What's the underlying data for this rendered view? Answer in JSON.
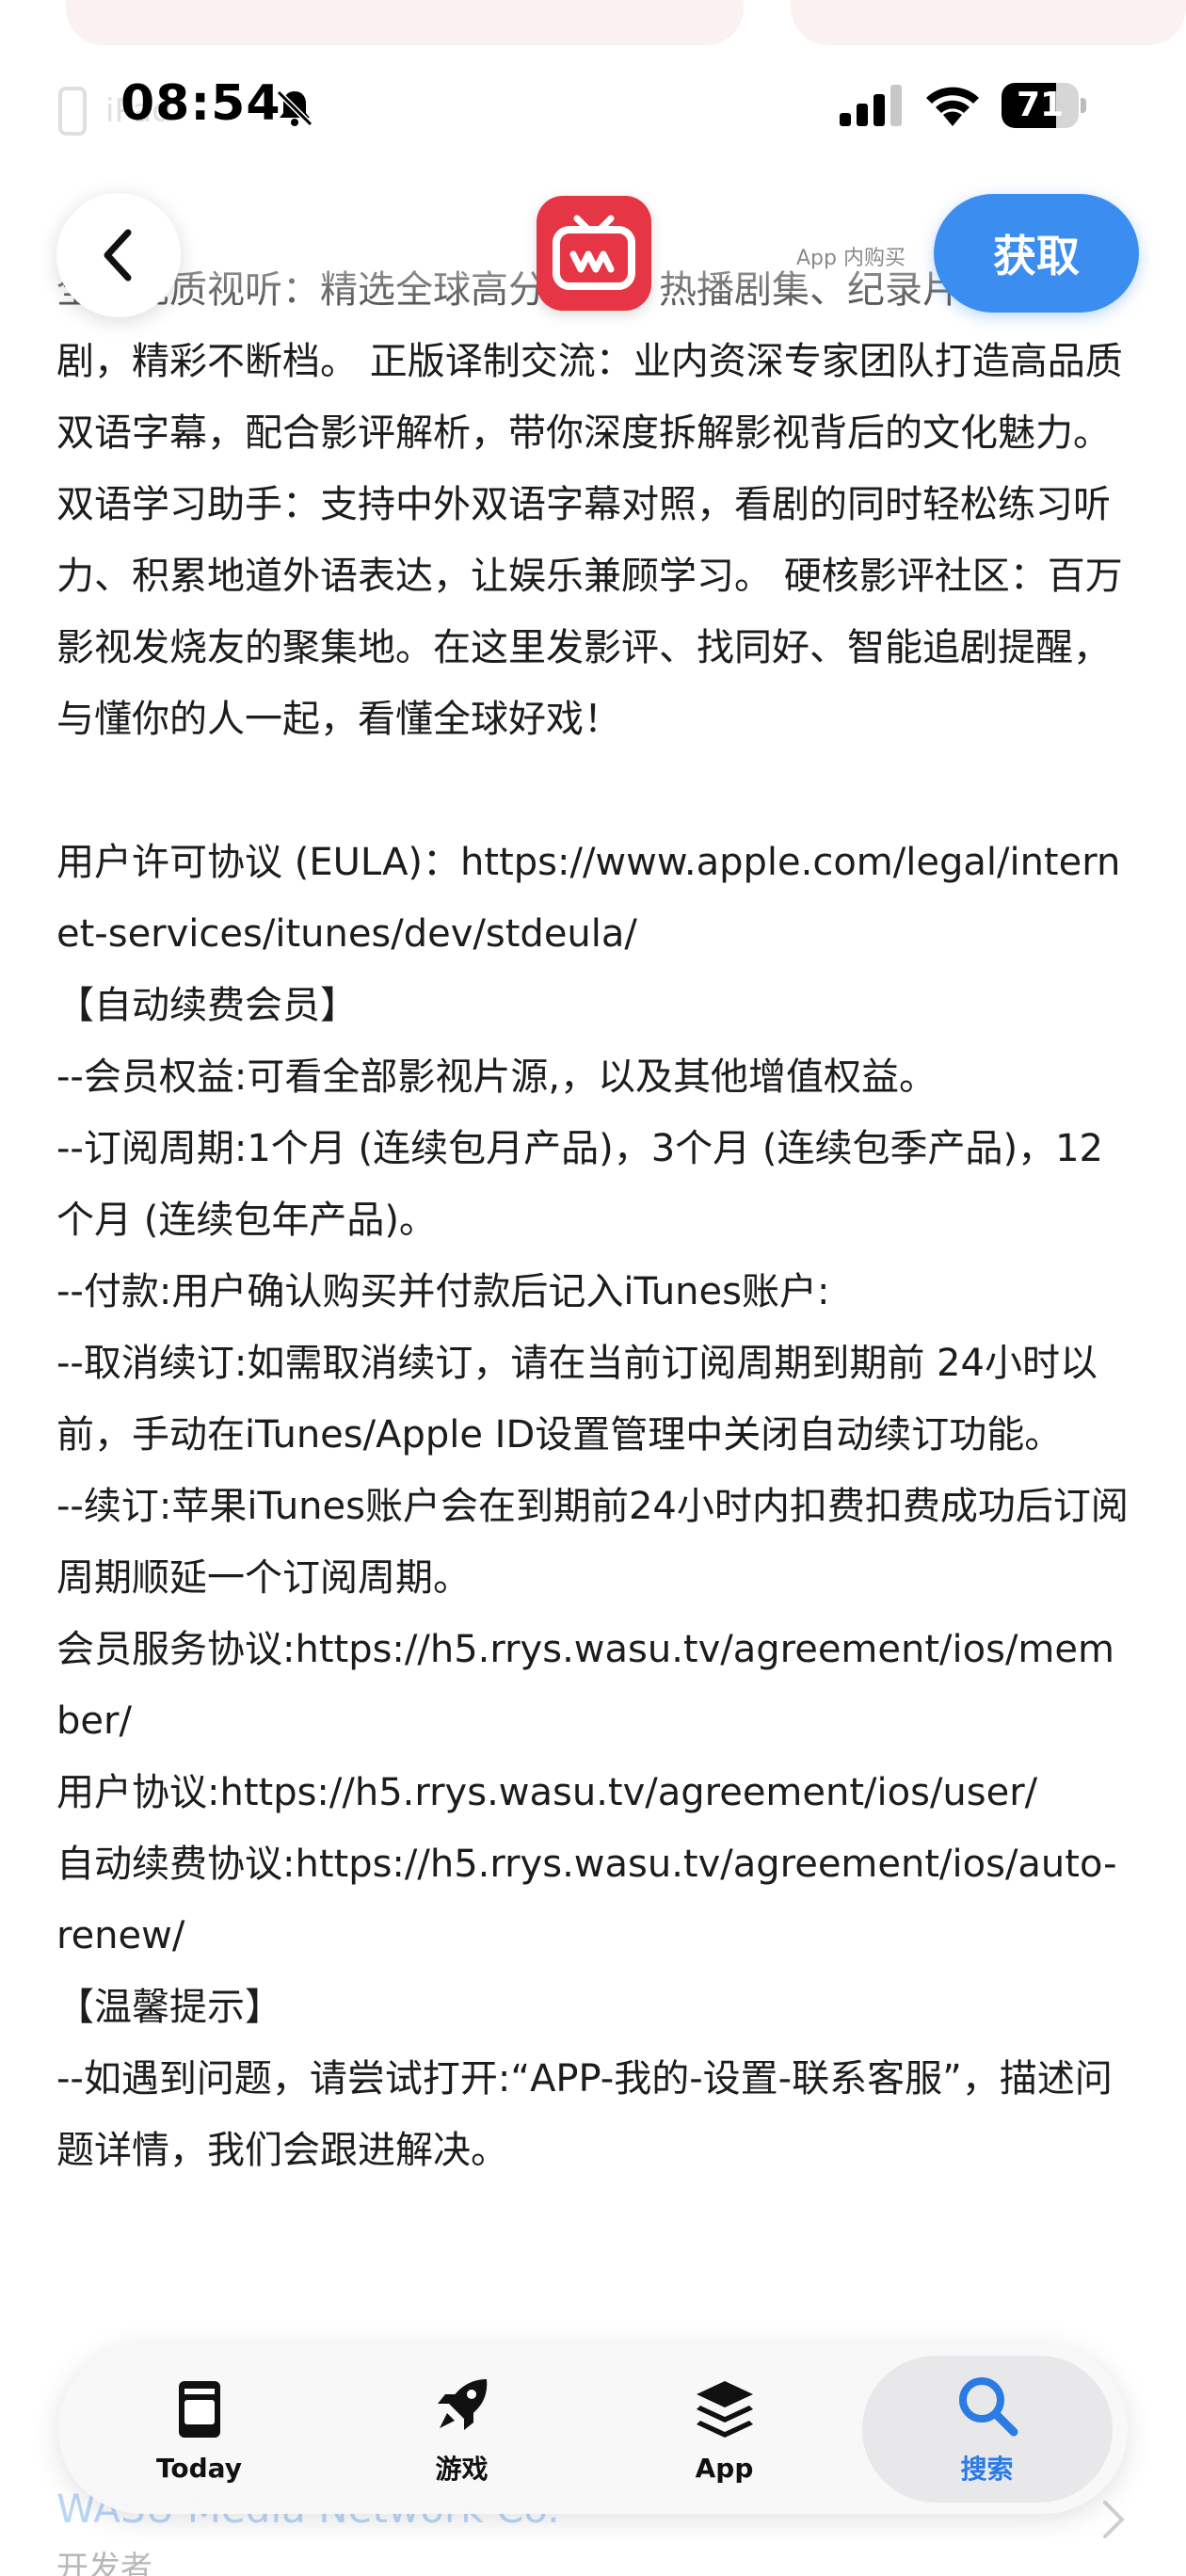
{
  "status_bar": {
    "time": "08:54",
    "battery_percent": "71",
    "battery_level": 0.71
  },
  "background": {
    "device_label": "iPad"
  },
  "header": {
    "in_app_purchase_label": "App 内购买",
    "get_label": "获取"
  },
  "description": {
    "paragraphs": [
      "全球优质视听：精选全球高分电影、热播剧集、纪录片及创意短剧，精彩不断档。 正版译制交流：业内资深专家团队打造高品质双语字幕，配合影评解析，带你深度拆解影视背后的文化魅力。 双语学习助手：支持中外双语字幕对照，看剧的同时轻松练习听力、积累地道外语表达，让娱乐兼顾学习。 硬核影评社区：百万影视发烧友的聚集地。在这里发影评、找同好、智能追剧提醒，与懂你的人一起，看懂全球好戏！",
      "用户许可协议 (EULA)：https://www.apple.com/legal/internet-services/itunes/dev/stdeula/\n【自动续费会员】\n--会员权益:可看全部影视片源,，以及其他增值权益。\n--订阅周期:1个月 (连续包月产品)，3个月 (连续包季产品)，12个月 (连续包年产品)。\n--付款:用户确认购买并付款后记入iTunes账户:\n--取消续订:如需取消续订，请在当前订阅周期到期前 24小时以前，手动在iTunes/Apple ID设置管理中关闭自动续订功能。\n--续订:苹果iTunes账户会在到期前24小时内扣费扣费成功后订阅周期顺延一个订阅周期。\n会员服务协议:https://h5.rrys.wasu.tv/agreement/ios/member/\n用户协议:https://h5.rrys.wasu.tv/agreement/ios/user/\n自动续费协议:https://h5.rrys.wasu.tv/agreement/ios/auto-renew/\n【温馨提示】\n--如遇到问题，请尝试打开:“APP-我的-设置-联系客服”，描述问题详情，我们会跟进解决。"
    ]
  },
  "tab_bar": {
    "tabs": [
      {
        "label": "Today",
        "icon": "today-icon",
        "active": false
      },
      {
        "label": "游戏",
        "icon": "rocket-icon",
        "active": false
      },
      {
        "label": "App",
        "icon": "app-stack-icon",
        "active": false
      },
      {
        "label": "搜索",
        "icon": "search-icon",
        "active": true
      }
    ]
  },
  "footer_ghost": {
    "developer_name": "WASU Media Network Co.",
    "developer_label": "开发者"
  },
  "colors": {
    "accent": "#3b8ef0",
    "app_icon": "#e63544",
    "active_tab": "#2a7be4"
  }
}
